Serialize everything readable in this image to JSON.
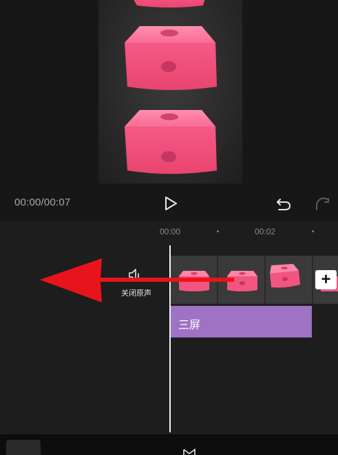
{
  "player": {
    "timecode": "00:00/00:07"
  },
  "icons": {
    "play": "play-icon",
    "undo": "undo-icon",
    "redo": "redo-icon",
    "mute": "speaker-icon",
    "add": "plus-icon"
  },
  "timeline": {
    "ruler": [
      "00:00",
      "00:02"
    ],
    "mute_label": "关闭原声",
    "add_label": "+",
    "text_clip_label": "三屏"
  },
  "colors": {
    "text_clip": "#9e72c4",
    "arrow": "#e8141b",
    "block": "#f25d83"
  }
}
